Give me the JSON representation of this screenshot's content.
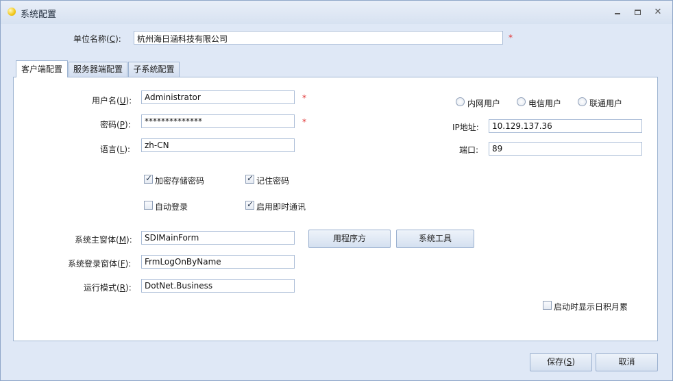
{
  "window": {
    "title": "系统配置"
  },
  "company": {
    "label_prefix": "单位名称(",
    "label_key": "C",
    "label_suffix": "):",
    "value": "杭州海日涵科技有限公司",
    "required_mark": "*"
  },
  "tabs": [
    {
      "label": "客户端配置"
    },
    {
      "label": "服务器端配置"
    },
    {
      "label": "子系统配置"
    }
  ],
  "client": {
    "username": {
      "label_prefix": "用户名(",
      "key": "U",
      "label_suffix": "):",
      "value": "Administrator",
      "required_mark": "*"
    },
    "password": {
      "label_prefix": "密码(",
      "key": "P",
      "label_suffix": "):",
      "value": "**************",
      "required_mark": "*"
    },
    "language": {
      "label_prefix": "语言(",
      "key": "L",
      "label_suffix": "):",
      "value": "zh-CN"
    },
    "checkboxes": {
      "encrypt_password": {
        "label": "加密存储密码",
        "checked": true
      },
      "remember_password": {
        "label": "记住密码",
        "checked": true
      },
      "auto_login": {
        "label": "自动登录",
        "checked": false
      },
      "enable_im": {
        "label": "启用即时通讯",
        "checked": true
      },
      "show_journal": {
        "label": "启动时显示日积月累",
        "checked": false
      }
    },
    "network": {
      "radios": [
        "内网用户",
        "电信用户",
        "联通用户"
      ],
      "ip_label": "IP地址:",
      "ip_value": "10.129.137.36",
      "port_label": "端口:",
      "port_value": "89"
    },
    "main_form": {
      "label_prefix": "系统主窗体(",
      "key": "M",
      "label_suffix": "):",
      "value": "SDIMainForm"
    },
    "login_form": {
      "label_prefix": "系统登录窗体(",
      "key": "F",
      "label_suffix": "):",
      "value": "FrmLogOnByName"
    },
    "run_mode": {
      "label_prefix": "运行模式(",
      "key": "R",
      "label_suffix": "):",
      "value": "DotNet.Business"
    },
    "buttons": {
      "program_recipe": "用程序方",
      "system_tools": "系统工具"
    }
  },
  "footer": {
    "save": {
      "prefix": "保存(",
      "key": "S",
      "suffix": ")"
    },
    "cancel": "取消"
  }
}
